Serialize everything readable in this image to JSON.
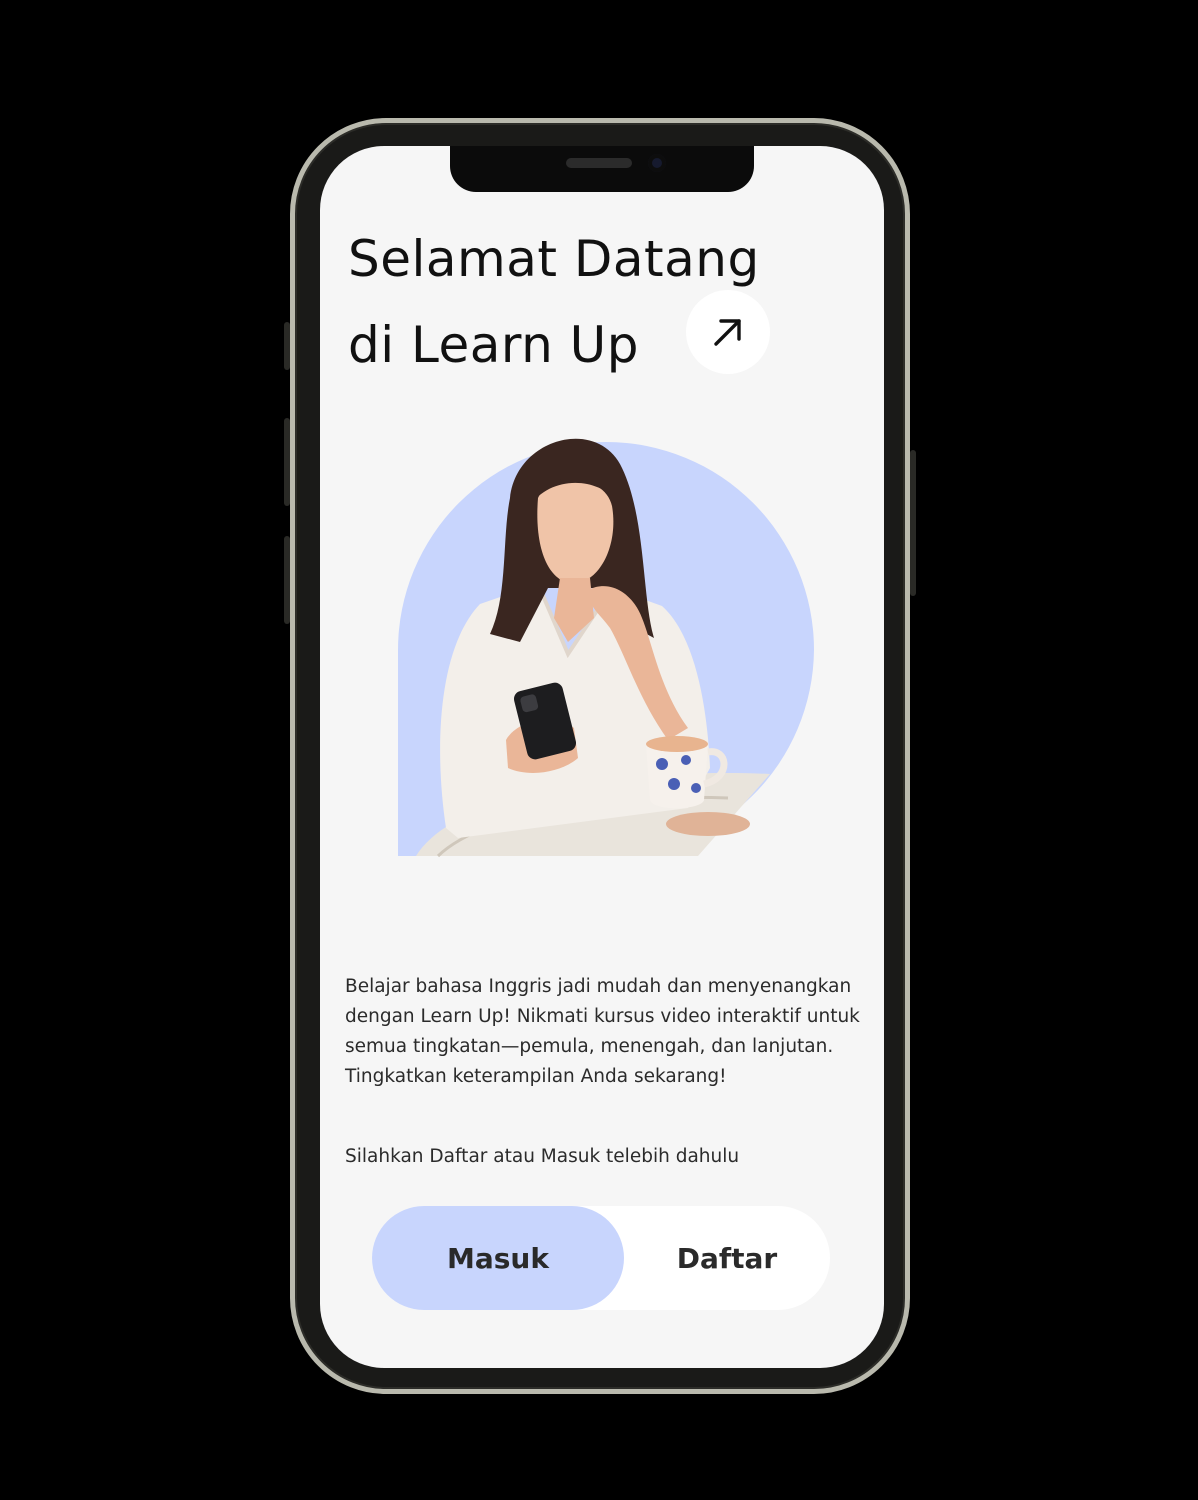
{
  "welcome": {
    "title_line1": "Selamat Datang",
    "title_line2": "di Learn Up",
    "arrow_icon": "arrow-up-right-icon"
  },
  "hero": {
    "accent_color": "#c8d5fd"
  },
  "description": "Belajar bahasa Inggris jadi mudah dan menyenangkan dengan Learn Up! Nikmati kursus video interaktif untuk semua tingkatan—pemula, menengah, dan lanjutan. Tingkatkan keterampilan Anda sekarang!",
  "cta_text": "Silahkan Daftar atau Masuk telebih dahulu",
  "auth": {
    "login_label": "Masuk",
    "register_label": "Daftar",
    "active_color": "#c8d5fd"
  }
}
